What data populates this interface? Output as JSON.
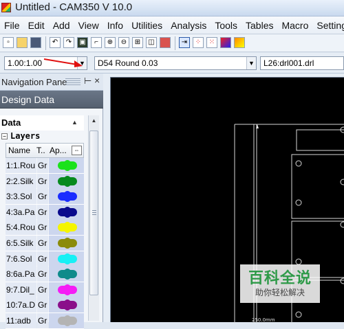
{
  "window": {
    "title": "Untitled - CAM350 V 10.0"
  },
  "menu": [
    {
      "label": "File"
    },
    {
      "label": "Edit"
    },
    {
      "label": "Add"
    },
    {
      "label": "View"
    },
    {
      "label": "Info"
    },
    {
      "label": "Utilities"
    },
    {
      "label": "Analysis"
    },
    {
      "label": "Tools"
    },
    {
      "label": "Tables"
    },
    {
      "label": "Macro"
    },
    {
      "label": "Settings"
    }
  ],
  "toolbar2": {
    "scale_value": "1.00:1.00",
    "dcode_value": "D54  Round 0.03",
    "layer_value": "L26:drl001.drl"
  },
  "nav": {
    "title": "Navigation Pane",
    "design_tab": "Design Data",
    "data_header": "Data",
    "layers_header": "Layers",
    "columns": {
      "name": "Name",
      "type": "T..",
      "appearance": "Ap..."
    },
    "layers": [
      {
        "name": "1:1.Rou",
        "type": "Gr",
        "color": "#1be21b"
      },
      {
        "name": "2:2.Silk",
        "type": "Gr",
        "color": "#068a1e"
      },
      {
        "name": "3:3.Sol",
        "type": "Gr",
        "color": "#1a2cff"
      },
      {
        "name": "4:3a.Pa",
        "type": "Gr",
        "color": "#0a0a8c"
      },
      {
        "name": "5:4.Rou",
        "type": "Gr",
        "color": "#f5f500"
      },
      {
        "name": "6:5.Silk",
        "type": "Gr",
        "color": "#8b8b0a"
      },
      {
        "name": "7:6.Sol",
        "type": "Gr",
        "color": "#17f0f5"
      },
      {
        "name": "8:6a.Pa",
        "type": "Gr",
        "color": "#0f8b8b"
      },
      {
        "name": "9:7.Dil_",
        "type": "Gr",
        "color": "#f51cf5"
      },
      {
        "name": "10:7a.D",
        "type": "Gr",
        "color": "#8a0f8a"
      },
      {
        "name": "11:adb",
        "type": "Gr",
        "color": "#b4b4b4"
      }
    ]
  },
  "canvas": {
    "dimension_label": "250.0mm"
  },
  "watermark": {
    "brand": "百科全说",
    "sub": "助你轻松解决"
  }
}
